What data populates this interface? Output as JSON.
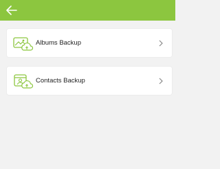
{
  "header": {
    "back_icon": "arrow-left-icon",
    "background_color": "#8cc63f"
  },
  "items": [
    {
      "label": "Albums Backup",
      "icon": "album-cloud-upload-icon",
      "chevron_icon": "chevron-right-icon"
    },
    {
      "label": "Contacts Backup",
      "icon": "contacts-cloud-upload-icon",
      "chevron_icon": "chevron-right-icon"
    }
  ],
  "colors": {
    "accent": "#8cc63f",
    "background": "#f2f2f2",
    "card": "#ffffff",
    "text": "#222222"
  }
}
